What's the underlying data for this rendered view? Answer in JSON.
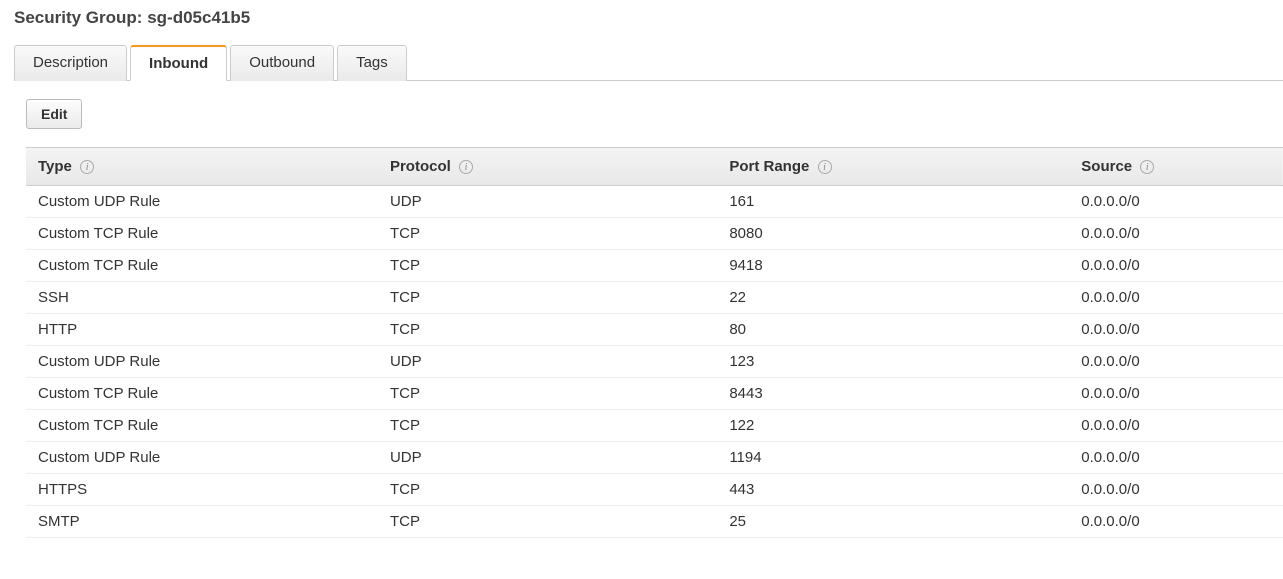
{
  "header": {
    "label": "Security Group:",
    "value": "sg-d05c41b5"
  },
  "tabs": [
    {
      "label": "Description",
      "active": false
    },
    {
      "label": "Inbound",
      "active": true
    },
    {
      "label": "Outbound",
      "active": false
    },
    {
      "label": "Tags",
      "active": false
    }
  ],
  "editButton": "Edit",
  "columns": {
    "type": "Type",
    "protocol": "Protocol",
    "portRange": "Port Range",
    "source": "Source"
  },
  "rules": [
    {
      "type": "Custom UDP Rule",
      "protocol": "UDP",
      "portRange": "161",
      "source": "0.0.0.0/0"
    },
    {
      "type": "Custom TCP Rule",
      "protocol": "TCP",
      "portRange": "8080",
      "source": "0.0.0.0/0"
    },
    {
      "type": "Custom TCP Rule",
      "protocol": "TCP",
      "portRange": "9418",
      "source": "0.0.0.0/0"
    },
    {
      "type": "SSH",
      "protocol": "TCP",
      "portRange": "22",
      "source": "0.0.0.0/0"
    },
    {
      "type": "HTTP",
      "protocol": "TCP",
      "portRange": "80",
      "source": "0.0.0.0/0"
    },
    {
      "type": "Custom UDP Rule",
      "protocol": "UDP",
      "portRange": "123",
      "source": "0.0.0.0/0"
    },
    {
      "type": "Custom TCP Rule",
      "protocol": "TCP",
      "portRange": "8443",
      "source": "0.0.0.0/0"
    },
    {
      "type": "Custom TCP Rule",
      "protocol": "TCP",
      "portRange": "122",
      "source": "0.0.0.0/0"
    },
    {
      "type": "Custom UDP Rule",
      "protocol": "UDP",
      "portRange": "1194",
      "source": "0.0.0.0/0"
    },
    {
      "type": "HTTPS",
      "protocol": "TCP",
      "portRange": "443",
      "source": "0.0.0.0/0"
    },
    {
      "type": "SMTP",
      "protocol": "TCP",
      "portRange": "25",
      "source": "0.0.0.0/0"
    }
  ]
}
